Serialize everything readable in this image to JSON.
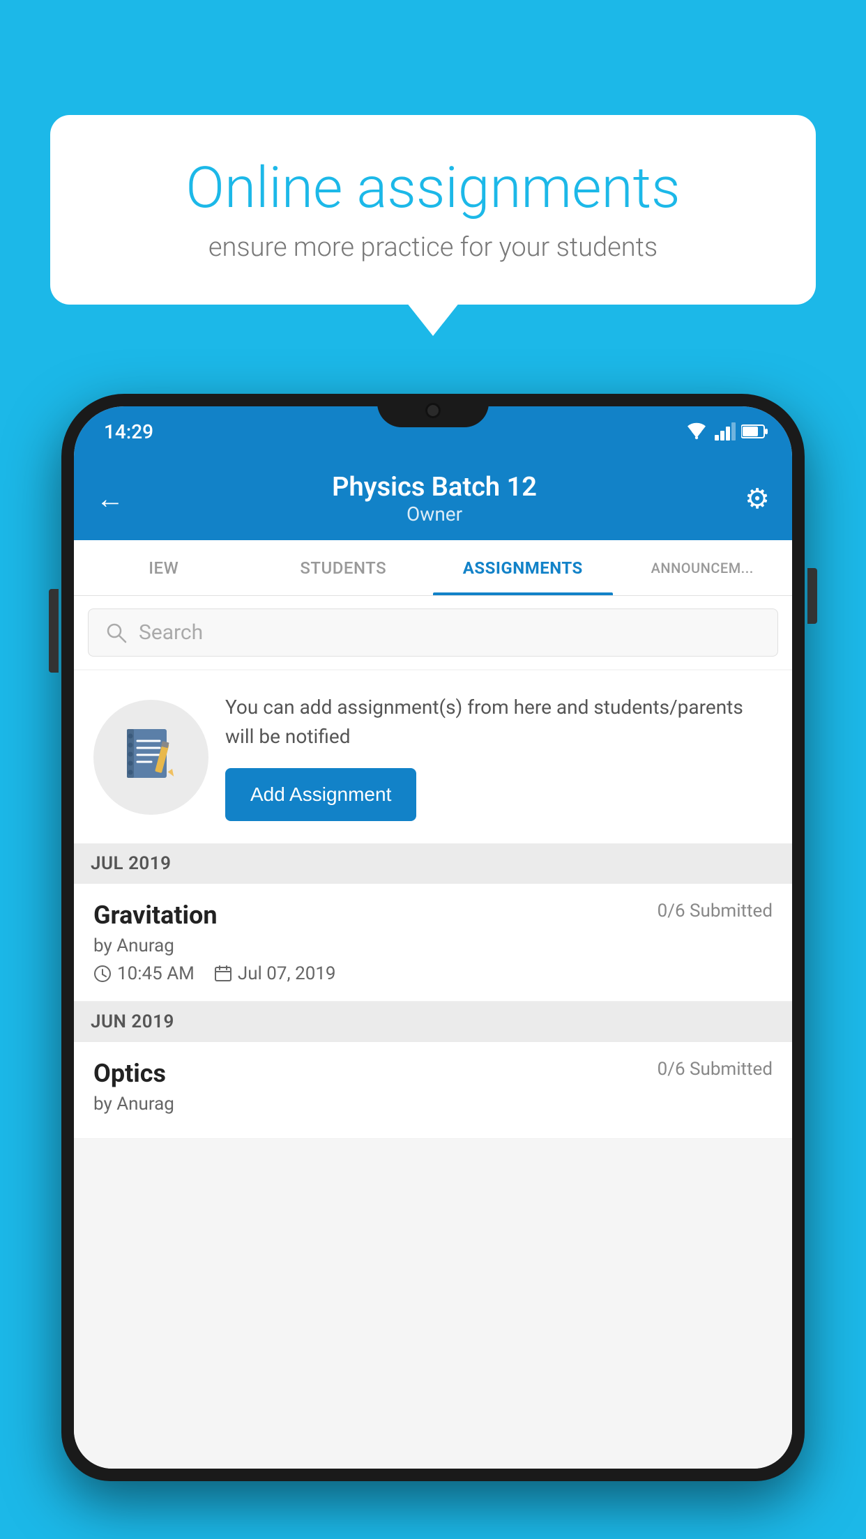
{
  "background_color": "#1cb8e8",
  "speech_bubble": {
    "title": "Online assignments",
    "subtitle": "ensure more practice for your students"
  },
  "status_bar": {
    "time": "14:29",
    "wifi": "wifi",
    "signal": "signal",
    "battery": "battery"
  },
  "header": {
    "back_label": "←",
    "title": "Physics Batch 12",
    "subtitle": "Owner",
    "settings_icon": "⚙"
  },
  "tabs": [
    {
      "label": "IEW",
      "active": false
    },
    {
      "label": "STUDENTS",
      "active": false
    },
    {
      "label": "ASSIGNMENTS",
      "active": true
    },
    {
      "label": "ANNOUNCEM...",
      "active": false
    }
  ],
  "search": {
    "placeholder": "Search"
  },
  "info_card": {
    "description": "You can add assignment(s) from here and students/parents will be notified",
    "button_label": "Add Assignment"
  },
  "sections": [
    {
      "month": "JUL 2019",
      "assignments": [
        {
          "name": "Gravitation",
          "submitted": "0/6 Submitted",
          "by": "by Anurag",
          "time": "10:45 AM",
          "date": "Jul 07, 2019"
        }
      ]
    },
    {
      "month": "JUN 2019",
      "assignments": [
        {
          "name": "Optics",
          "submitted": "0/6 Submitted",
          "by": "by Anurag",
          "time": "",
          "date": ""
        }
      ]
    }
  ]
}
